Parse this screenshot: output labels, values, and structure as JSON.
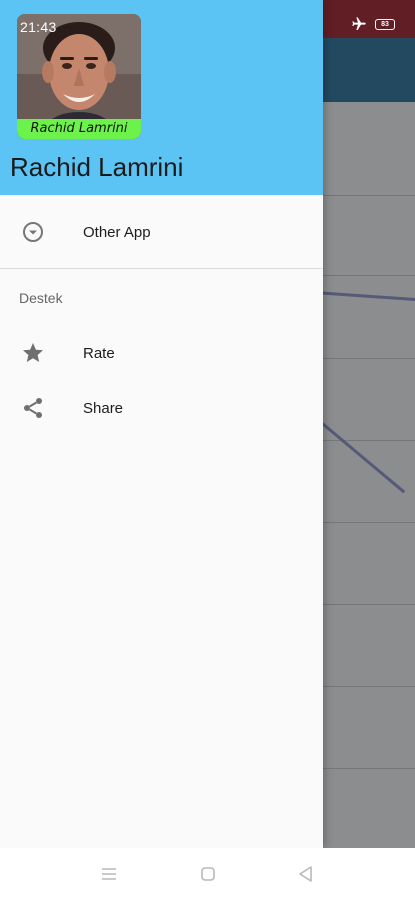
{
  "status_bar": {
    "time": "21:43",
    "battery_level": "83"
  },
  "drawer": {
    "header_color": "#5bc4f5",
    "avatar_caption": "Rachid Lamrini",
    "title": "Rachid Lamrini",
    "items": [
      {
        "label": "Other App",
        "icon": "chevron-down-circle-icon"
      }
    ],
    "section": {
      "title": "Destek",
      "items": [
        {
          "label": "Rate",
          "icon": "star-icon"
        },
        {
          "label": "Share",
          "icon": "share-icon"
        }
      ]
    }
  },
  "navigation_bar": {
    "buttons": [
      {
        "icon": "menu-icon"
      },
      {
        "icon": "home-icon"
      },
      {
        "icon": "back-icon"
      }
    ]
  }
}
